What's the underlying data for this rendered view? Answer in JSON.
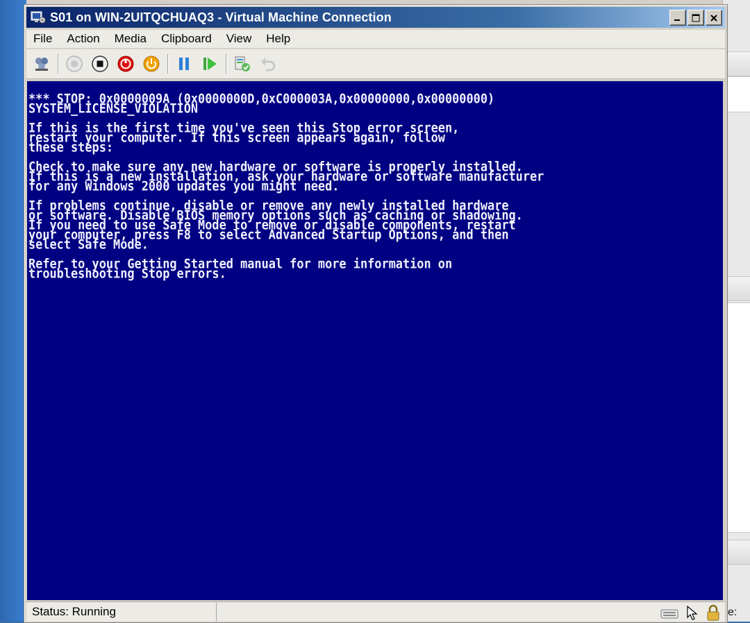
{
  "window": {
    "title": "S01 on WIN-2UITQCHUAQ3 - Virtual Machine Connection"
  },
  "menu": [
    "File",
    "Action",
    "Media",
    "Clipboard",
    "View",
    "Help"
  ],
  "toolbar": {
    "buttons": [
      "ctrl-alt-del-icon",
      "start-icon",
      "turn-off-icon",
      "shut-down-icon",
      "power-icon",
      "pause-icon",
      "resume-icon",
      "snapshot-icon",
      "revert-icon"
    ]
  },
  "screen": {
    "lines": [
      "*** STOP: 0x0000009A (0x0000000D,0xC000003A,0x00000000,0x00000000)",
      "SYSTEM_LICENSE_VIOLATION",
      "",
      "If this is the first time you've seen this Stop error screen,",
      "restart your computer. If this screen appears again, follow",
      "these steps:",
      "",
      "Check to make sure any new hardware or software is properly installed.",
      "If this is a new installation, ask your hardware or software manufacturer",
      "for any Windows 2000 updates you might need.",
      "",
      "If problems continue, disable or remove any newly installed hardware",
      "or software. Disable BIOS memory options such as caching or shadowing.",
      "If you need to use Safe Mode to remove or disable components, restart",
      "your computer, press F8 to select Advanced Startup Options, and then",
      "select Safe Mode.",
      "",
      "Refer to your Getting Started manual for more information on",
      "troubleshooting Stop errors."
    ],
    "background_color": "#000082",
    "text_color": "#f0f0ff"
  },
  "status": {
    "text": "Status: Running"
  },
  "background_window": {
    "label_fragment": "e:"
  }
}
